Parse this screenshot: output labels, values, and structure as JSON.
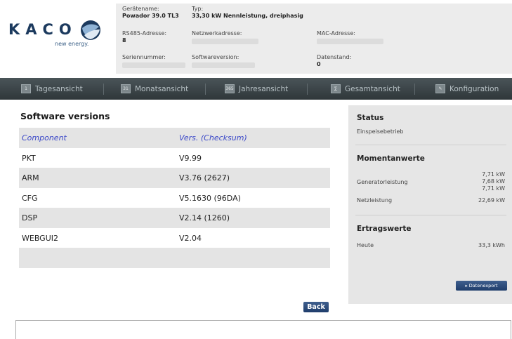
{
  "brand": {
    "name": "KACO",
    "tagline": "new energy."
  },
  "device": {
    "name_label": "Gerätename:",
    "name_value": "Powador 39.0 TL3",
    "type_label": "Typ:",
    "type_value": "33,30 kW Nennleistung, dreiphasig",
    "rs485_label": "RS485-Adresse:",
    "rs485_value": "8",
    "network_label": "Netzwerkadresse:",
    "mac_label": "MAC-Adresse:",
    "serial_label": "Seriennummer:",
    "software_label": "Softwareversion:",
    "datastand_label": "Datenstand:",
    "datastand_value": "0"
  },
  "nav": {
    "items": [
      {
        "label": "Tagesansicht",
        "icon": "calendar-day-icon"
      },
      {
        "label": "Monatsansicht",
        "icon": "calendar-month-icon"
      },
      {
        "label": "Jahresansicht",
        "icon": "calendar-year-icon"
      },
      {
        "label": "Gesamtansicht",
        "icon": "overview-icon"
      },
      {
        "label": "Konfiguration",
        "icon": "wrench-icon"
      }
    ]
  },
  "software": {
    "title": "Software versions",
    "headers": [
      "Component",
      "Vers. (Checksum)"
    ],
    "rows": [
      [
        "PKT",
        "V9.99"
      ],
      [
        "ARM",
        "V3.76 (2627)"
      ],
      [
        "CFG",
        "V5.1630 (96DA)"
      ],
      [
        "DSP",
        "V2.14 (1260)"
      ],
      [
        "WEBGUI2",
        "V2.04"
      ]
    ],
    "back_label": "Back"
  },
  "side": {
    "status_title": "Status",
    "status_value": "Einspeisebetrieb",
    "moment_title": "Momentanwerte",
    "generator_label": "Generatorleistung",
    "generator_values": [
      "7,71 kW",
      "7,68 kW",
      "7,71 kW"
    ],
    "netz_label": "Netzleistung",
    "netz_value": "22,69 kW",
    "ertrag_title": "Ertragswerte",
    "heute_label": "Heute",
    "heute_value": "33,3 kWh",
    "export_label": "▸ Datenexport"
  }
}
